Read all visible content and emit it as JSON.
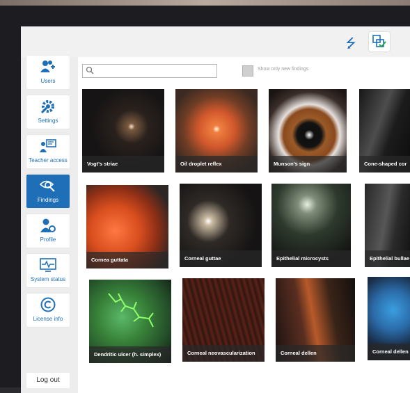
{
  "topbar": {
    "usb_icon": "usb-icon",
    "sync_icon": "sync-check-icon",
    "accent": "#1e6fb8"
  },
  "sidebar": {
    "items": [
      {
        "label": "Users",
        "icon": "users-add-icon"
      },
      {
        "label": "Settings",
        "icon": "settings-gear-icon"
      },
      {
        "label": "Teacher access",
        "icon": "teacher-icon"
      },
      {
        "label": "Findings",
        "icon": "findings-eye-icon",
        "active": true
      },
      {
        "label": "Profile",
        "icon": "profile-gear-icon"
      },
      {
        "label": "System status",
        "icon": "system-status-icon"
      },
      {
        "label": "License info",
        "icon": "copyright-icon"
      }
    ],
    "logout_label": "Log out"
  },
  "main": {
    "search": {
      "placeholder": "",
      "value": ""
    },
    "filter_label": "Show only new findings",
    "findings": [
      "Vogt's striae",
      "Oil droplet reflex",
      "Munson's sign",
      "Cone-shaped cor",
      "Cornea guttata",
      "Corneal guttae",
      "Epithelial microcysts",
      "Epithelial bullae",
      "Dendritic ulcer (h. simplex)",
      "Corneal neovascularization",
      "Corneal dellen",
      "Corneal dellen"
    ]
  }
}
